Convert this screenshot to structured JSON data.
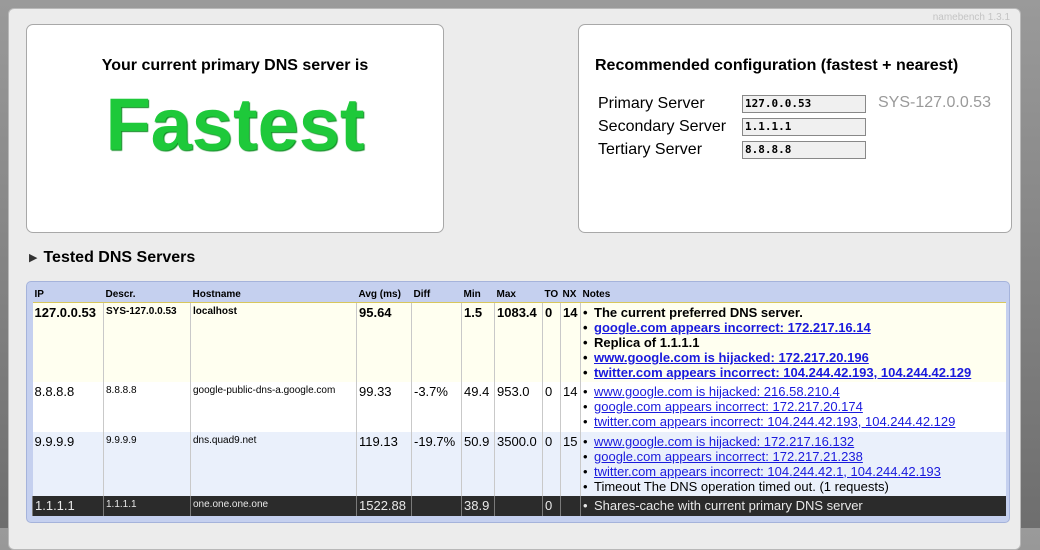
{
  "version": "namebench 1.3.1",
  "current": {
    "title": "Your current primary DNS server is",
    "verdict": "Fastest"
  },
  "recommended": {
    "title": "Recommended configuration (fastest + nearest)",
    "primary_label": "Primary Server",
    "primary_value": "127.0.0.53",
    "primary_descr": "SYS-127.0.0.53",
    "secondary_label": "Secondary Server",
    "secondary_value": "1.1.1.1",
    "tertiary_label": "Tertiary Server",
    "tertiary_value": "8.8.8.8"
  },
  "tested": {
    "title": "Tested DNS Servers",
    "columns": [
      "IP",
      "Descr.",
      "Hostname",
      "Avg (ms)",
      "Diff",
      "Min",
      "Max",
      "TO",
      "NX",
      "Notes"
    ],
    "rows": [
      {
        "ip": "127.0.0.53",
        "descr": "SYS-127.0.0.53",
        "hostname": "localhost",
        "avg": "95.64",
        "diff": "",
        "min": "1.5",
        "max": "1083.4",
        "to": "0",
        "nx": "14",
        "notes": [
          {
            "text": "The current preferred DNS server.",
            "link": false
          },
          {
            "text": "google.com appears incorrect: 172.217.16.14",
            "link": true
          },
          {
            "text": "Replica of 1.1.1.1",
            "link": false
          },
          {
            "text": "www.google.com is hijacked: 172.217.20.196",
            "link": true
          },
          {
            "text": "twitter.com appears incorrect: 104.244.42.193, 104.244.42.129",
            "link": true
          }
        ]
      },
      {
        "ip": "8.8.8.8",
        "descr": "8.8.8.8",
        "hostname": "google-public-dns-a.google.com",
        "avg": "99.33",
        "diff": "-3.7%",
        "min": "49.4",
        "max": "953.0",
        "to": "0",
        "nx": "14",
        "notes": [
          {
            "text": "www.google.com is hijacked: 216.58.210.4",
            "link": true
          },
          {
            "text": "google.com appears incorrect: 172.217.20.174",
            "link": true
          },
          {
            "text": "twitter.com appears incorrect: 104.244.42.193, 104.244.42.129",
            "link": true
          }
        ]
      },
      {
        "ip": "9.9.9.9",
        "descr": "9.9.9.9",
        "hostname": "dns.quad9.net",
        "avg": "119.13",
        "diff": "-19.7%",
        "min": "50.9",
        "max": "3500.0",
        "to": "0",
        "nx": "15",
        "notes": [
          {
            "text": "www.google.com is hijacked: 172.217.16.132",
            "link": true
          },
          {
            "text": "google.com appears incorrect: 172.217.21.238",
            "link": true
          },
          {
            "text": "twitter.com appears incorrect: 104.244.42.1, 104.244.42.193",
            "link": true
          },
          {
            "text": "Timeout The DNS operation timed out. (1 requests)",
            "link": false
          }
        ]
      },
      {
        "ip": "1.1.1.1",
        "descr": "1.1.1.1",
        "hostname": "one.one.one.one",
        "avg": "1522.88",
        "diff": "",
        "min": "38.9",
        "max": "",
        "to": "0",
        "nx": "",
        "notes": [
          {
            "text": "Shares-cache with current primary DNS server",
            "link": false
          }
        ]
      }
    ]
  }
}
